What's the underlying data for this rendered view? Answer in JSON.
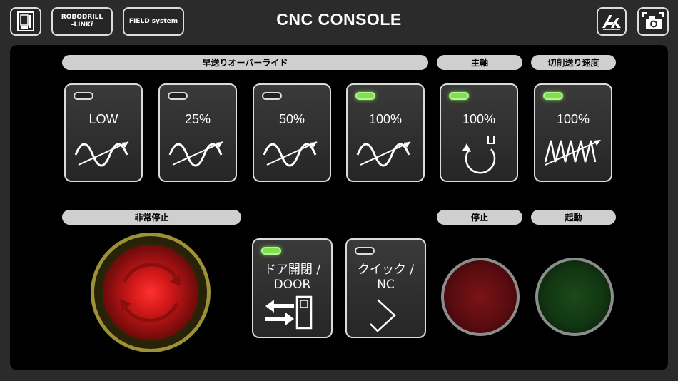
{
  "header": {
    "title": "CNC CONSOLE",
    "robodrill_label_1": "ROBODRILL",
    "robodrill_label_2": "-LINK",
    "robodrill_label_i": "i",
    "field_system_label": "FIELD system"
  },
  "sections": {
    "rapid_override": "早送りオーバーライド",
    "spindle": "主軸",
    "feed_rate": "切削送り速度",
    "emergency_stop": "非常停止",
    "stop": "停止",
    "start": "起動"
  },
  "rapid_buttons": [
    {
      "label": "LOW",
      "led_on": false
    },
    {
      "label": "25%",
      "led_on": false
    },
    {
      "label": "50%",
      "led_on": false
    },
    {
      "label": "100%",
      "led_on": true
    }
  ],
  "spindle_button": {
    "label": "100%",
    "led_on": true
  },
  "feed_button": {
    "label": "100%",
    "led_on": true
  },
  "door_button": {
    "label_line1": "ドア開閉 /",
    "label_line2": "DOOR",
    "led_on": true
  },
  "quick_button": {
    "label_line1": "クイック /",
    "label_line2": "NC",
    "led_on": false
  },
  "colors": {
    "led_on": "#7ee04a",
    "stop_lamp": "#c0202a",
    "start_lamp": "#2f8a2f",
    "estop_red": "#ff2020",
    "estop_ring": "#b5a83a"
  }
}
